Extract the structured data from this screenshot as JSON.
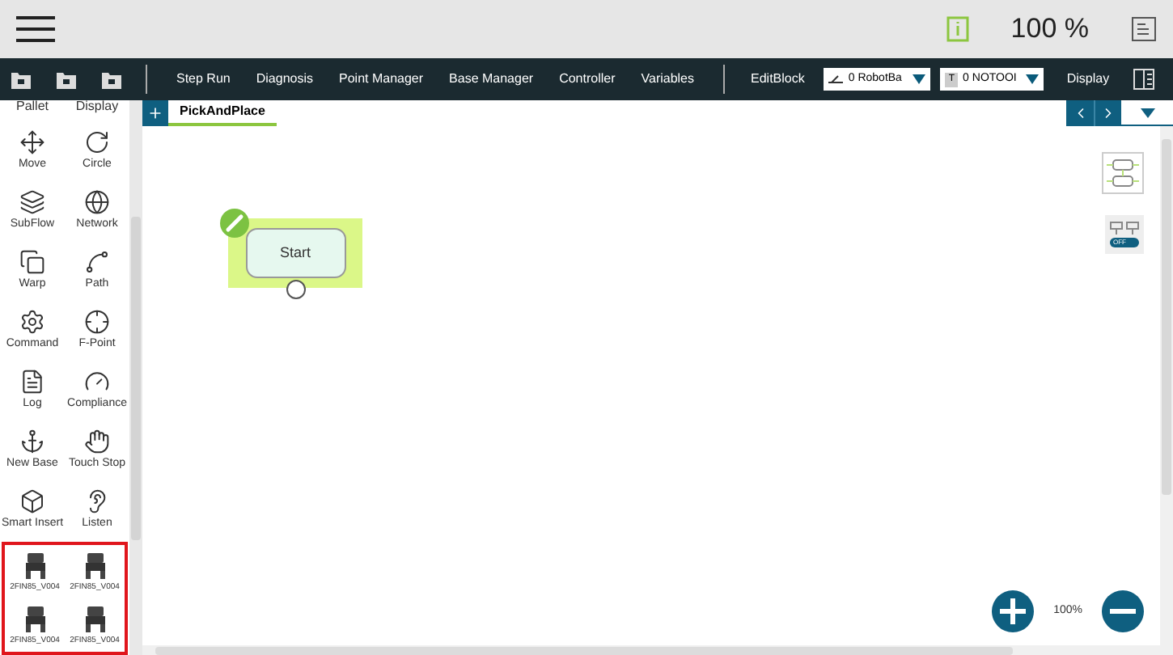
{
  "header": {
    "zoom": "100 %"
  },
  "toolbar": {
    "buttons": [
      "Step Run",
      "Diagnosis",
      "Point Manager",
      "Base Manager",
      "Controller",
      "Variables"
    ],
    "edit_block": "EditBlock",
    "base_dropdown": {
      "value": "0 RobotBa"
    },
    "tool_dropdown": {
      "badge": "T",
      "value": "0 NOTOOI"
    },
    "display": "Display"
  },
  "palette": {
    "items": [
      {
        "label": "Pallet",
        "kind": "pallet"
      },
      {
        "label": "Display",
        "kind": "display"
      },
      {
        "label": "Move",
        "kind": "move"
      },
      {
        "label": "Circle",
        "kind": "circle"
      },
      {
        "label": "SubFlow",
        "kind": "subflow"
      },
      {
        "label": "Network",
        "kind": "network"
      },
      {
        "label": "Warp",
        "kind": "warp"
      },
      {
        "label": "Path",
        "kind": "path"
      },
      {
        "label": "Command",
        "kind": "command"
      },
      {
        "label": "F-Point",
        "kind": "fpoint"
      },
      {
        "label": "Log",
        "kind": "log"
      },
      {
        "label": "Compliance",
        "kind": "compliance"
      },
      {
        "label": "New Base",
        "kind": "newbase"
      },
      {
        "label": "Touch Stop",
        "kind": "touchstop"
      },
      {
        "label": "Smart Insert",
        "kind": "smartinsert"
      },
      {
        "label": "Listen",
        "kind": "listen"
      }
    ],
    "gripper_items": [
      {
        "label": "2FIN85_V004"
      },
      {
        "label": "2FIN85_V004"
      },
      {
        "label": "2FIN85_V004"
      },
      {
        "label": "2FIN85_V004"
      }
    ]
  },
  "tabs": [
    {
      "label": "PickAndPlace",
      "selected": true
    }
  ],
  "canvas": {
    "nodes": [
      {
        "label": "Start",
        "selected": true
      }
    ],
    "toggle": {
      "label": "OFF",
      "on": false
    },
    "zoom": "100%"
  }
}
